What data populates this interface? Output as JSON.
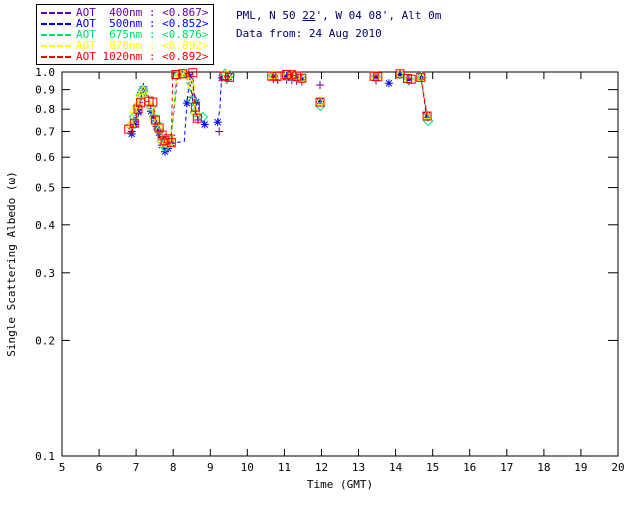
{
  "header": {
    "line1_pre": "PML, N 50 ",
    "line1_underlined": "22",
    "line1_post": "', W 04 08', Alt 0m",
    "line2": "Data from: 24 Aug 2010"
  },
  "legend": {
    "items": [
      {
        "id": "400nm",
        "label": "AOT  400nm : <0.867>",
        "color": "#6600AA"
      },
      {
        "id": "500nm",
        "label": "AOT  500nm : <0.852>",
        "color": "#0000FF"
      },
      {
        "id": "675nm",
        "label": "AOT  675nm : <0.876>",
        "color": "#00DD66"
      },
      {
        "id": "870nm",
        "label": "AOT  870nm : <0.892>",
        "color": "#FFFF00"
      },
      {
        "id": "1020nm",
        "label": "AOT 1020nm : <0.892>",
        "color": "#FF0000"
      }
    ]
  },
  "colors": {
    "axis": "#000000",
    "title_text": "#000066",
    "background": "#FFFFFF"
  },
  "chart_data": {
    "type": "line",
    "title": "",
    "xlabel": "Time (GMT)",
    "ylabel": "Single Scattering Albedo (ω)",
    "xlim": [
      5,
      20
    ],
    "ylim": [
      0.1,
      1.0
    ],
    "yscale": "log",
    "grid": false,
    "legend_position": "top-left",
    "xticks": [
      5,
      6,
      7,
      8,
      9,
      10,
      11,
      12,
      13,
      14,
      15,
      16,
      17,
      18,
      19,
      20
    ],
    "yticks": [
      1.0,
      0.9,
      0.8,
      0.7,
      0.6,
      0.5,
      0.4,
      0.3,
      0.2,
      0.1
    ],
    "line_style": "dashed",
    "series": [
      {
        "name": "AOT 400nm",
        "wavelength": "400nm",
        "aot_mean": "<0.867>",
        "color": "#6600AA",
        "marker": "plus",
        "segments": [
          [
            [
              6.88,
              0.7
            ],
            [
              6.97,
              0.745
            ],
            [
              7.06,
              0.8
            ],
            [
              7.13,
              0.86
            ],
            [
              7.2,
              0.915
            ],
            [
              7.32,
              0.875,
              0
            ],
            [
              7.4,
              0.8
            ],
            [
              7.48,
              0.77
            ],
            [
              7.55,
              0.74
            ],
            [
              7.62,
              0.71
            ],
            [
              7.7,
              0.675
            ],
            [
              7.78,
              0.648
            ],
            [
              7.86,
              0.66
            ],
            [
              7.95,
              0.685
            ],
            [
              8.12,
              0.97,
              0
            ],
            [
              8.2,
              0.98
            ],
            [
              8.35,
              0.985
            ],
            [
              8.45,
              0.93,
              0
            ],
            [
              8.52,
              0.86
            ],
            [
              8.6,
              0.79
            ],
            [
              8.67,
              0.75
            ]
          ],
          [
            [
              9.24,
              0.7
            ]
          ],
          [
            [
              9.45,
              0.955
            ]
          ],
          [
            [
              10.7,
              0.958
            ],
            [
              10.82,
              0.953
            ]
          ],
          [
            [
              11.06,
              0.955
            ],
            [
              11.2,
              0.952
            ],
            [
              11.33,
              0.949
            ],
            [
              11.47,
              0.944
            ]
          ],
          [
            [
              11.96,
              0.925
            ]
          ],
          [
            [
              13.47,
              0.95
            ]
          ],
          [
            [
              14.36,
              0.945
            ]
          ],
          [
            [
              14.7,
              0.955
            ],
            [
              14.82,
              0.782
            ]
          ]
        ]
      },
      {
        "name": "AOT 500nm",
        "wavelength": "500nm",
        "aot_mean": "<0.852>",
        "color": "#0000FF",
        "marker": "asterisk",
        "segments": [
          [
            [
              6.88,
              0.69
            ],
            [
              6.97,
              0.73
            ],
            [
              7.06,
              0.785
            ],
            [
              7.14,
              0.885
            ],
            [
              7.2,
              0.89
            ],
            [
              7.32,
              0.86,
              0
            ],
            [
              7.4,
              0.79
            ],
            [
              7.48,
              0.755
            ],
            [
              7.55,
              0.72
            ],
            [
              7.62,
              0.695
            ],
            [
              7.7,
              0.645
            ],
            [
              7.78,
              0.62
            ],
            [
              7.86,
              0.632
            ],
            [
              7.95,
              0.652
            ],
            [
              8.3,
              0.66,
              0
            ],
            [
              8.37,
              0.83
            ],
            [
              8.45,
              0.975
            ],
            [
              8.55,
              0.9,
              0
            ],
            [
              8.62,
              0.835
            ],
            [
              8.85,
              0.73
            ]
          ],
          [
            [
              9.2,
              0.74
            ],
            [
              9.26,
              0.8,
              0
            ],
            [
              9.28,
              0.88,
              0
            ],
            [
              9.31,
              0.965
            ],
            [
              9.5,
              0.97
            ]
          ],
          [
            [
              10.7,
              0.975
            ]
          ],
          [
            [
              11.06,
              0.975
            ],
            [
              11.2,
              0.972
            ],
            [
              11.33,
              0.968
            ],
            [
              11.47,
              0.958
            ]
          ],
          [
            [
              11.96,
              0.838
            ]
          ],
          [
            [
              13.47,
              0.97
            ]
          ],
          [
            [
              13.82,
              0.935
            ]
          ],
          [
            [
              14.12,
              0.985
            ]
          ],
          [
            [
              14.36,
              0.955
            ]
          ],
          [
            [
              14.7,
              0.968
            ],
            [
              14.85,
              0.762
            ]
          ]
        ]
      },
      {
        "name": "AOT 675nm",
        "wavelength": "675nm",
        "aot_mean": "<0.876>",
        "color": "#00DD66",
        "marker": "diamond",
        "segments": [
          [
            [
              6.85,
              0.725
            ],
            [
              6.94,
              0.765
            ],
            [
              7.03,
              0.815
            ],
            [
              7.12,
              0.87
            ],
            [
              7.19,
              0.9
            ],
            [
              7.32,
              0.865,
              0
            ],
            [
              7.4,
              0.81
            ],
            [
              7.48,
              0.765
            ],
            [
              7.55,
              0.735
            ],
            [
              7.62,
              0.705
            ],
            [
              7.7,
              0.66
            ],
            [
              7.78,
              0.638
            ],
            [
              7.86,
              0.648
            ],
            [
              7.94,
              0.668
            ],
            [
              8.08,
              0.96,
              0
            ],
            [
              8.14,
              0.985
            ],
            [
              8.28,
              0.99
            ],
            [
              8.45,
              0.9,
              0
            ],
            [
              8.52,
              0.84
            ],
            [
              8.58,
              0.785
            ],
            [
              8.8,
              0.763
            ]
          ],
          [
            [
              9.4,
              0.99
            ],
            [
              9.53,
              0.982
            ]
          ],
          [
            [
              10.7,
              0.978
            ]
          ],
          [
            [
              11.06,
              0.978
            ],
            [
              11.2,
              0.975
            ],
            [
              11.33,
              0.972
            ],
            [
              11.47,
              0.962
            ]
          ],
          [
            [
              11.97,
              0.815
            ]
          ],
          [
            [
              13.47,
              0.972
            ]
          ],
          [
            [
              14.12,
              0.988
            ]
          ],
          [
            [
              14.36,
              0.958
            ]
          ],
          [
            [
              14.7,
              0.965
            ],
            [
              14.88,
              0.745
            ]
          ]
        ]
      },
      {
        "name": "AOT 870nm",
        "wavelength": "870nm",
        "aot_mean": "<0.892>",
        "color": "#FFFF00",
        "marker": "triangle",
        "segments": [
          [
            [
              6.86,
              0.735
            ],
            [
              6.94,
              0.8
            ],
            [
              7.04,
              0.822
            ],
            [
              7.12,
              0.875
            ],
            [
              7.19,
              0.895
            ],
            [
              7.32,
              0.86,
              0
            ],
            [
              7.4,
              0.815
            ],
            [
              7.48,
              0.77
            ],
            [
              7.55,
              0.742
            ],
            [
              7.62,
              0.712
            ],
            [
              7.7,
              0.668
            ],
            [
              7.78,
              0.652
            ],
            [
              7.86,
              0.66
            ],
            [
              7.94,
              0.678
            ],
            [
              8.1,
              0.97,
              0
            ],
            [
              8.17,
              0.988
            ],
            [
              8.32,
              0.985
            ],
            [
              8.5,
              0.93
            ],
            [
              8.6,
              0.79
            ]
          ],
          [
            [
              9.45,
              0.985
            ]
          ],
          [
            [
              10.7,
              0.982
            ]
          ],
          [
            [
              11.06,
              0.985
            ],
            [
              11.2,
              0.982
            ],
            [
              11.33,
              0.978
            ],
            [
              11.47,
              0.968
            ]
          ],
          [
            [
              11.96,
              0.84
            ]
          ],
          [
            [
              13.47,
              0.978
            ]
          ],
          [
            [
              14.12,
              0.992
            ]
          ],
          [
            [
              14.36,
              0.965
            ]
          ],
          [
            [
              14.7,
              0.972
            ],
            [
              14.85,
              0.772
            ]
          ]
        ]
      },
      {
        "name": "AOT 1020nm",
        "wavelength": "1020nm",
        "aot_mean": "<0.892>",
        "color": "#FF0000",
        "marker": "square",
        "segments": [
          [
            [
              6.8,
              0.71
            ],
            [
              6.95,
              0.735
            ],
            [
              7.05,
              0.8
            ],
            [
              7.12,
              0.832
            ],
            [
              7.35,
              0.84
            ],
            [
              7.45,
              0.835
            ],
            [
              7.52,
              0.75
            ],
            [
              7.62,
              0.715
            ],
            [
              7.7,
              0.685
            ],
            [
              7.78,
              0.662
            ],
            [
              7.86,
              0.67
            ],
            [
              7.95,
              0.655
            ],
            [
              7.99,
              1.0,
              0
            ],
            [
              8.07,
              0.985
            ],
            [
              8.26,
              0.99
            ],
            [
              8.53,
              0.995
            ],
            [
              8.56,
              0.86,
              0
            ],
            [
              8.6,
              0.81
            ],
            [
              8.65,
              0.758
            ]
          ],
          [
            [
              9.37,
              0.975
            ],
            [
              9.52,
              0.968
            ]
          ],
          [
            [
              10.66,
              0.975
            ],
            [
              10.8,
              0.974
            ]
          ],
          [
            [
              11.06,
              0.985
            ],
            [
              11.2,
              0.984
            ],
            [
              11.33,
              0.975
            ],
            [
              11.47,
              0.963
            ]
          ],
          [
            [
              11.96,
              0.835
            ]
          ],
          [
            [
              13.42,
              0.975
            ],
            [
              13.52,
              0.972
            ]
          ],
          [
            [
              14.12,
              0.99
            ]
          ],
          [
            [
              14.32,
              0.962
            ],
            [
              14.42,
              0.958
            ]
          ],
          [
            [
              14.68,
              0.968
            ],
            [
              14.85,
              0.768
            ]
          ]
        ]
      }
    ]
  }
}
